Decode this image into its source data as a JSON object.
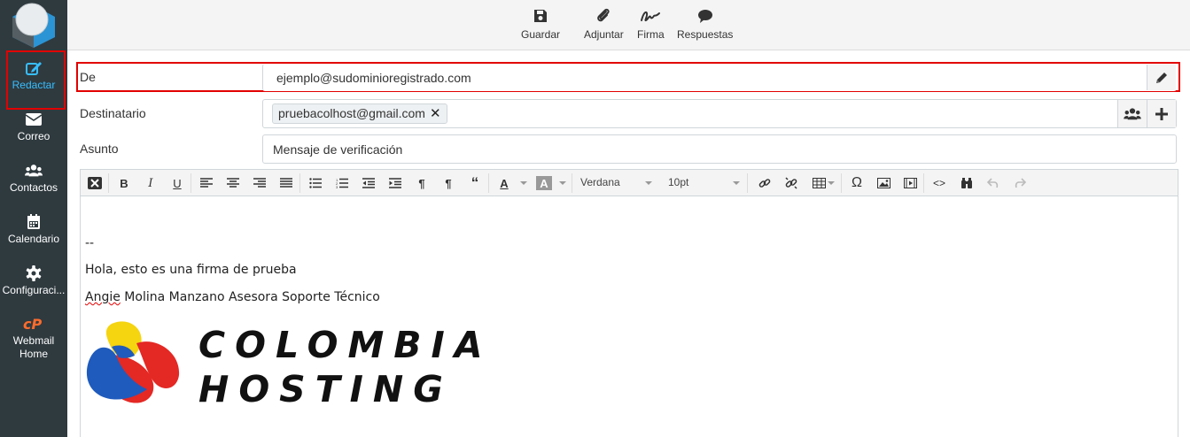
{
  "sidebar": {
    "items": [
      {
        "label": "Redactar",
        "icon": "compose-icon",
        "active": true
      },
      {
        "label": "Correo",
        "icon": "envelope-icon"
      },
      {
        "label": "Contactos",
        "icon": "contacts-icon"
      },
      {
        "label": "Calendario",
        "icon": "calendar-icon"
      },
      {
        "label": "Configuraci...",
        "icon": "gear-icon"
      },
      {
        "label": "Webmail Home",
        "icon": "cpanel-icon"
      }
    ],
    "active_color": "#37beff",
    "background": "#2f3a3f"
  },
  "toolbar": {
    "save_label": "Guardar",
    "attach_label": "Adjuntar",
    "signature_label": "Firma",
    "responses_label": "Respuestas"
  },
  "form": {
    "from_label": "De",
    "from_value": "ejemplo@sudominioregistrado.com",
    "to_label": "Destinatario",
    "to_recipient": "pruebacolhost@gmail.com",
    "subject_label": "Asunto",
    "subject_value": "Mensaje de verificación"
  },
  "editor": {
    "font_family": "Verdana",
    "font_size": "10pt",
    "body": {
      "separator": "--",
      "line1": "Hola, esto es una firma de prueba",
      "line2_first": "Angie",
      "line2_rest": " Molina Manzano Asesora Soporte Técnico"
    },
    "signature_logo": {
      "line1": "COLOMBIA",
      "line2": "HOSTING"
    }
  },
  "highlight_color": "#e20000"
}
